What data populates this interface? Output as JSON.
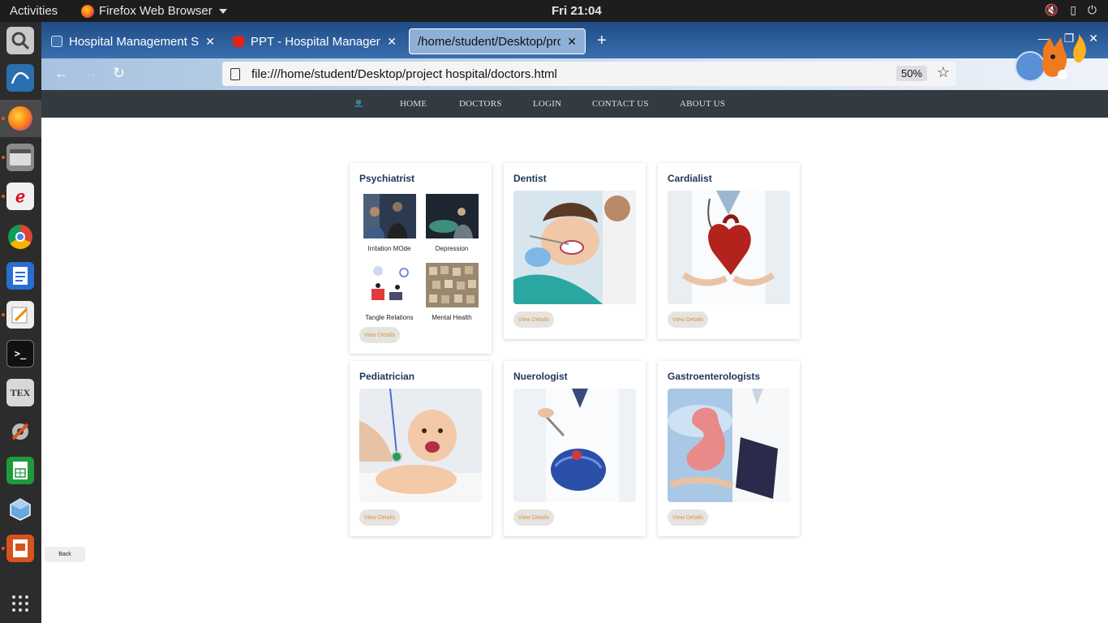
{
  "topbar": {
    "activities": "Activities",
    "app_name": "Firefox Web Browser",
    "clock": "Fri 21:04"
  },
  "browser": {
    "tabs": [
      {
        "title": "Hospital Management Sy"
      },
      {
        "title": "PPT - Hospital Manageme"
      },
      {
        "title": "/home/student/Desktop/pro"
      }
    ],
    "url": "file:///home/student/Desktop/project hospital/doctors.html",
    "zoom": "50%"
  },
  "site_nav": {
    "links": [
      "HOME",
      "DOCTORS",
      "LOGIN",
      "CONTACT US",
      "ABOUT US"
    ]
  },
  "cards": [
    {
      "title": "Psychiatrist",
      "sub_items": [
        "Irritation MOde",
        "Depression",
        "Tangle Relations",
        "Mental Health"
      ],
      "button": "View Details"
    },
    {
      "title": "Dentist",
      "button": "View Details"
    },
    {
      "title": "Cardialist",
      "button": "View Details"
    },
    {
      "title": "Pediatrician",
      "button": "View Details"
    },
    {
      "title": "Nuerologist",
      "button": "View Details"
    },
    {
      "title": "Gastroenterologists",
      "button": "View Details"
    }
  ],
  "back_label": "Back",
  "colors": {
    "site_nav_bg": "#333a40",
    "card_title": "#1c3656",
    "button_text": "#d8953a",
    "button_bg": "#e6e4e2"
  }
}
